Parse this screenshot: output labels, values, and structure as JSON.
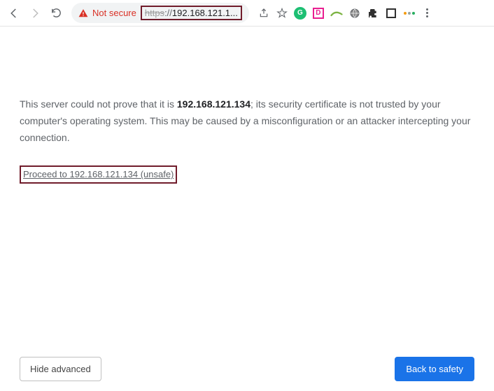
{
  "toolbar": {
    "not_secure_label": "Not secure",
    "url_scheme": "https",
    "url_separator": "://",
    "url_display": "192.168.121.1..."
  },
  "warning": {
    "text_prefix": "This server could not prove that it is ",
    "host_bold": "192.168.121.134",
    "text_suffix": "; its security certificate is not trusted by your computer's operating system. This may be caused by a misconfiguration or an attacker intercepting your connection."
  },
  "proceed": {
    "label": "Proceed to 192.168.121.134 (unsafe)"
  },
  "buttons": {
    "hide_advanced": "Hide advanced",
    "back_to_safety": "Back to safety"
  }
}
